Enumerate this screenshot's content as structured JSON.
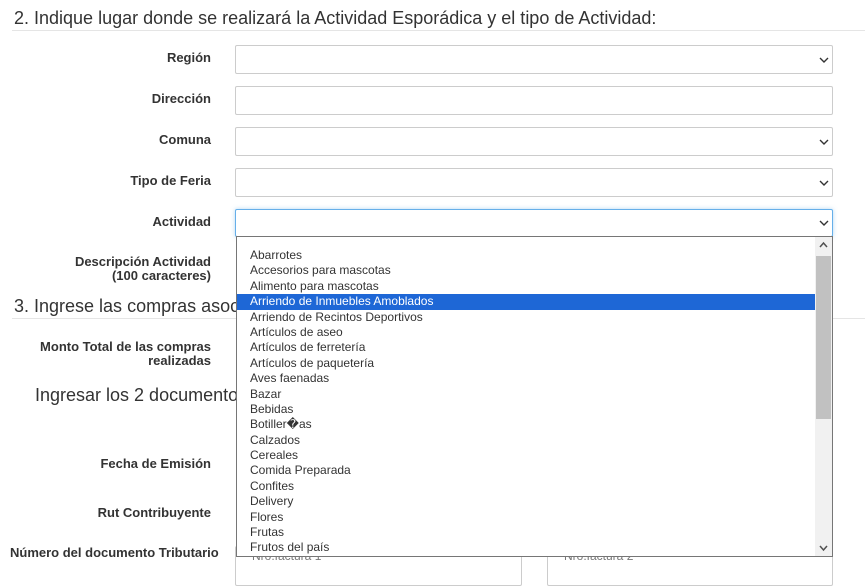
{
  "section2": {
    "title": "2. Indique lugar donde se realizará la Actividad Esporádica y el tipo de Actividad:"
  },
  "labels": {
    "region": "Región",
    "direccion": "Dirección",
    "comuna": "Comuna",
    "tipo_feria": "Tipo de Feria",
    "actividad": "Actividad",
    "descripcion_line1": "Descripción Actividad",
    "descripcion_line2": "(100 caracteres)",
    "monto_line1": "Monto Total de las compras",
    "monto_line2": "realizadas",
    "fecha_emision": "Fecha de Emisión",
    "rut_contribuyente": "Rut Contribuyente",
    "numero_documento": "Número del documento Tributario"
  },
  "fields": {
    "region_value": "",
    "direccion_value": "",
    "comuna_value": "",
    "tipo_feria_value": "",
    "actividad_value": ""
  },
  "section3": {
    "title": "3. Ingrese las compras asoci"
  },
  "ingresar": {
    "title": "Ingresar los 2 documento"
  },
  "ghost_texts": {
    "left": "Nro.factura 1",
    "right": "Nro.factura 2"
  },
  "dropdown": {
    "selected_index": 3,
    "options": [
      "Abarrotes",
      "Accesorios para mascotas",
      "Alimento para mascotas",
      "Arriendo de Inmuebles Amoblados",
      "Arriendo de Recintos Deportivos",
      "Artículos de aseo",
      "Artículos de ferretería",
      "Artículos de paquetería",
      "Aves faenadas",
      "Bazar",
      "Bebidas",
      "Botiller�as",
      "Calzados",
      "Cereales",
      "Comida Preparada",
      "Confites",
      "Delivery",
      "Flores",
      "Frutas",
      "Frutos del país"
    ]
  },
  "colors": {
    "selected_bg": "#1e67d6",
    "focus_border": "#66afe9",
    "field_border": "#cccccc"
  },
  "icons": {
    "select_arrow": "chevron-down-icon",
    "scroll_up": "triangle-up-icon",
    "scroll_down": "triangle-down-icon"
  }
}
